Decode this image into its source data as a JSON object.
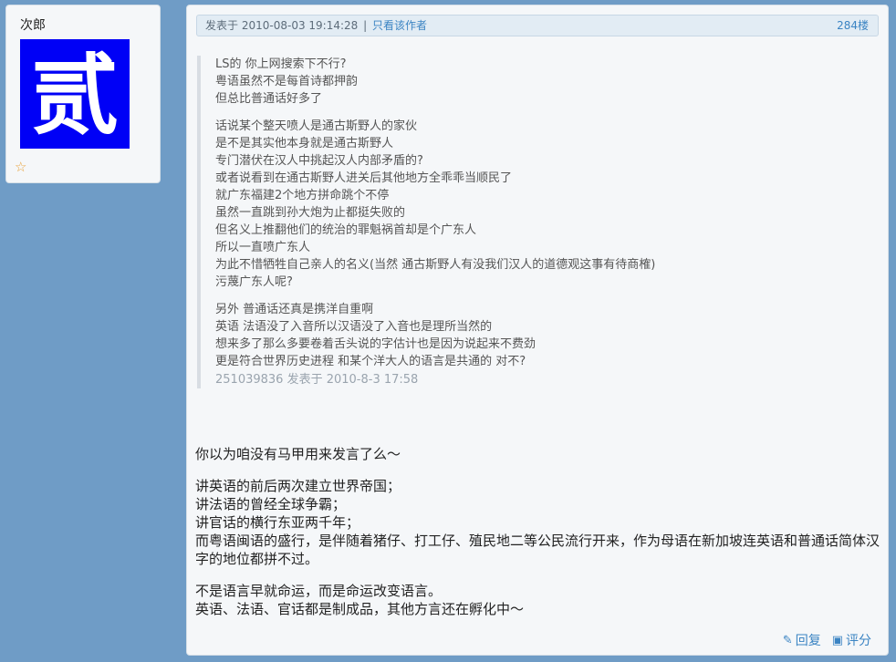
{
  "user": {
    "name": "次郎",
    "avatar_char": "贰",
    "rank_icon": "star-outline-icon"
  },
  "post": {
    "header": {
      "posted_label": "发表于",
      "timestamp": "2010-08-03 19:14:28",
      "author_only_link": "只看该作者",
      "floor": "284楼"
    },
    "quote": {
      "paragraphs": [
        [
          "LS的 你上网搜索下不行?",
          "粤语虽然不是每首诗都押韵",
          "但总比普通话好多了"
        ],
        [
          "话说某个整天喷人是通古斯野人的家伙",
          "是不是其实他本身就是通古斯野人",
          "专门潜伏在汉人中挑起汉人内部矛盾的?",
          "或者说看到在通古斯野人进关后其他地方全乖乖当顺民了",
          "就广东福建2个地方拼命跳个不停",
          "虽然一直跳到孙大炮为止都挺失败的",
          "但名义上推翻他们的统治的罪魁祸首却是个广东人",
          "所以一直喷广东人",
          "为此不惜牺牲自己亲人的名义(当然 通古斯野人有没我们汉人的道德观这事有待商榷)",
          "污蔑广东人呢?"
        ],
        [
          "另外 普通话还真是携洋自重啊",
          "英语 法语没了入音所以汉语没了入音也是理所当然的",
          "想来多了那么多要卷着舌头说的字估计也是因为说起来不费劲",
          "更是符合世界历史进程 和某个洋大人的语言是共通的 对不?"
        ]
      ],
      "source": "251039836 发表于 2010-8-3 17:58"
    },
    "body": {
      "paragraphs": [
        [
          "你以为咱没有马甲用来发言了么～"
        ],
        [
          "讲英语的前后两次建立世界帝国；",
          "讲法语的曾经全球争霸；",
          "讲官话的横行东亚两千年；",
          "而粤语闽语的盛行，是伴随着猪仔、打工仔、殖民地二等公民流行开来，作为母语在新加坡连英语和普通话简体汉字的地位都拼不过。"
        ],
        [
          "不是语言早就命运，而是命运改变语言。",
          "英语、法语、官话都是制成品，其他方言还在孵化中～"
        ]
      ]
    },
    "actions": {
      "reply": "回复",
      "rate": "评分",
      "reply_icon": "pencil-icon",
      "rate_icon": "camera-icon"
    }
  }
}
